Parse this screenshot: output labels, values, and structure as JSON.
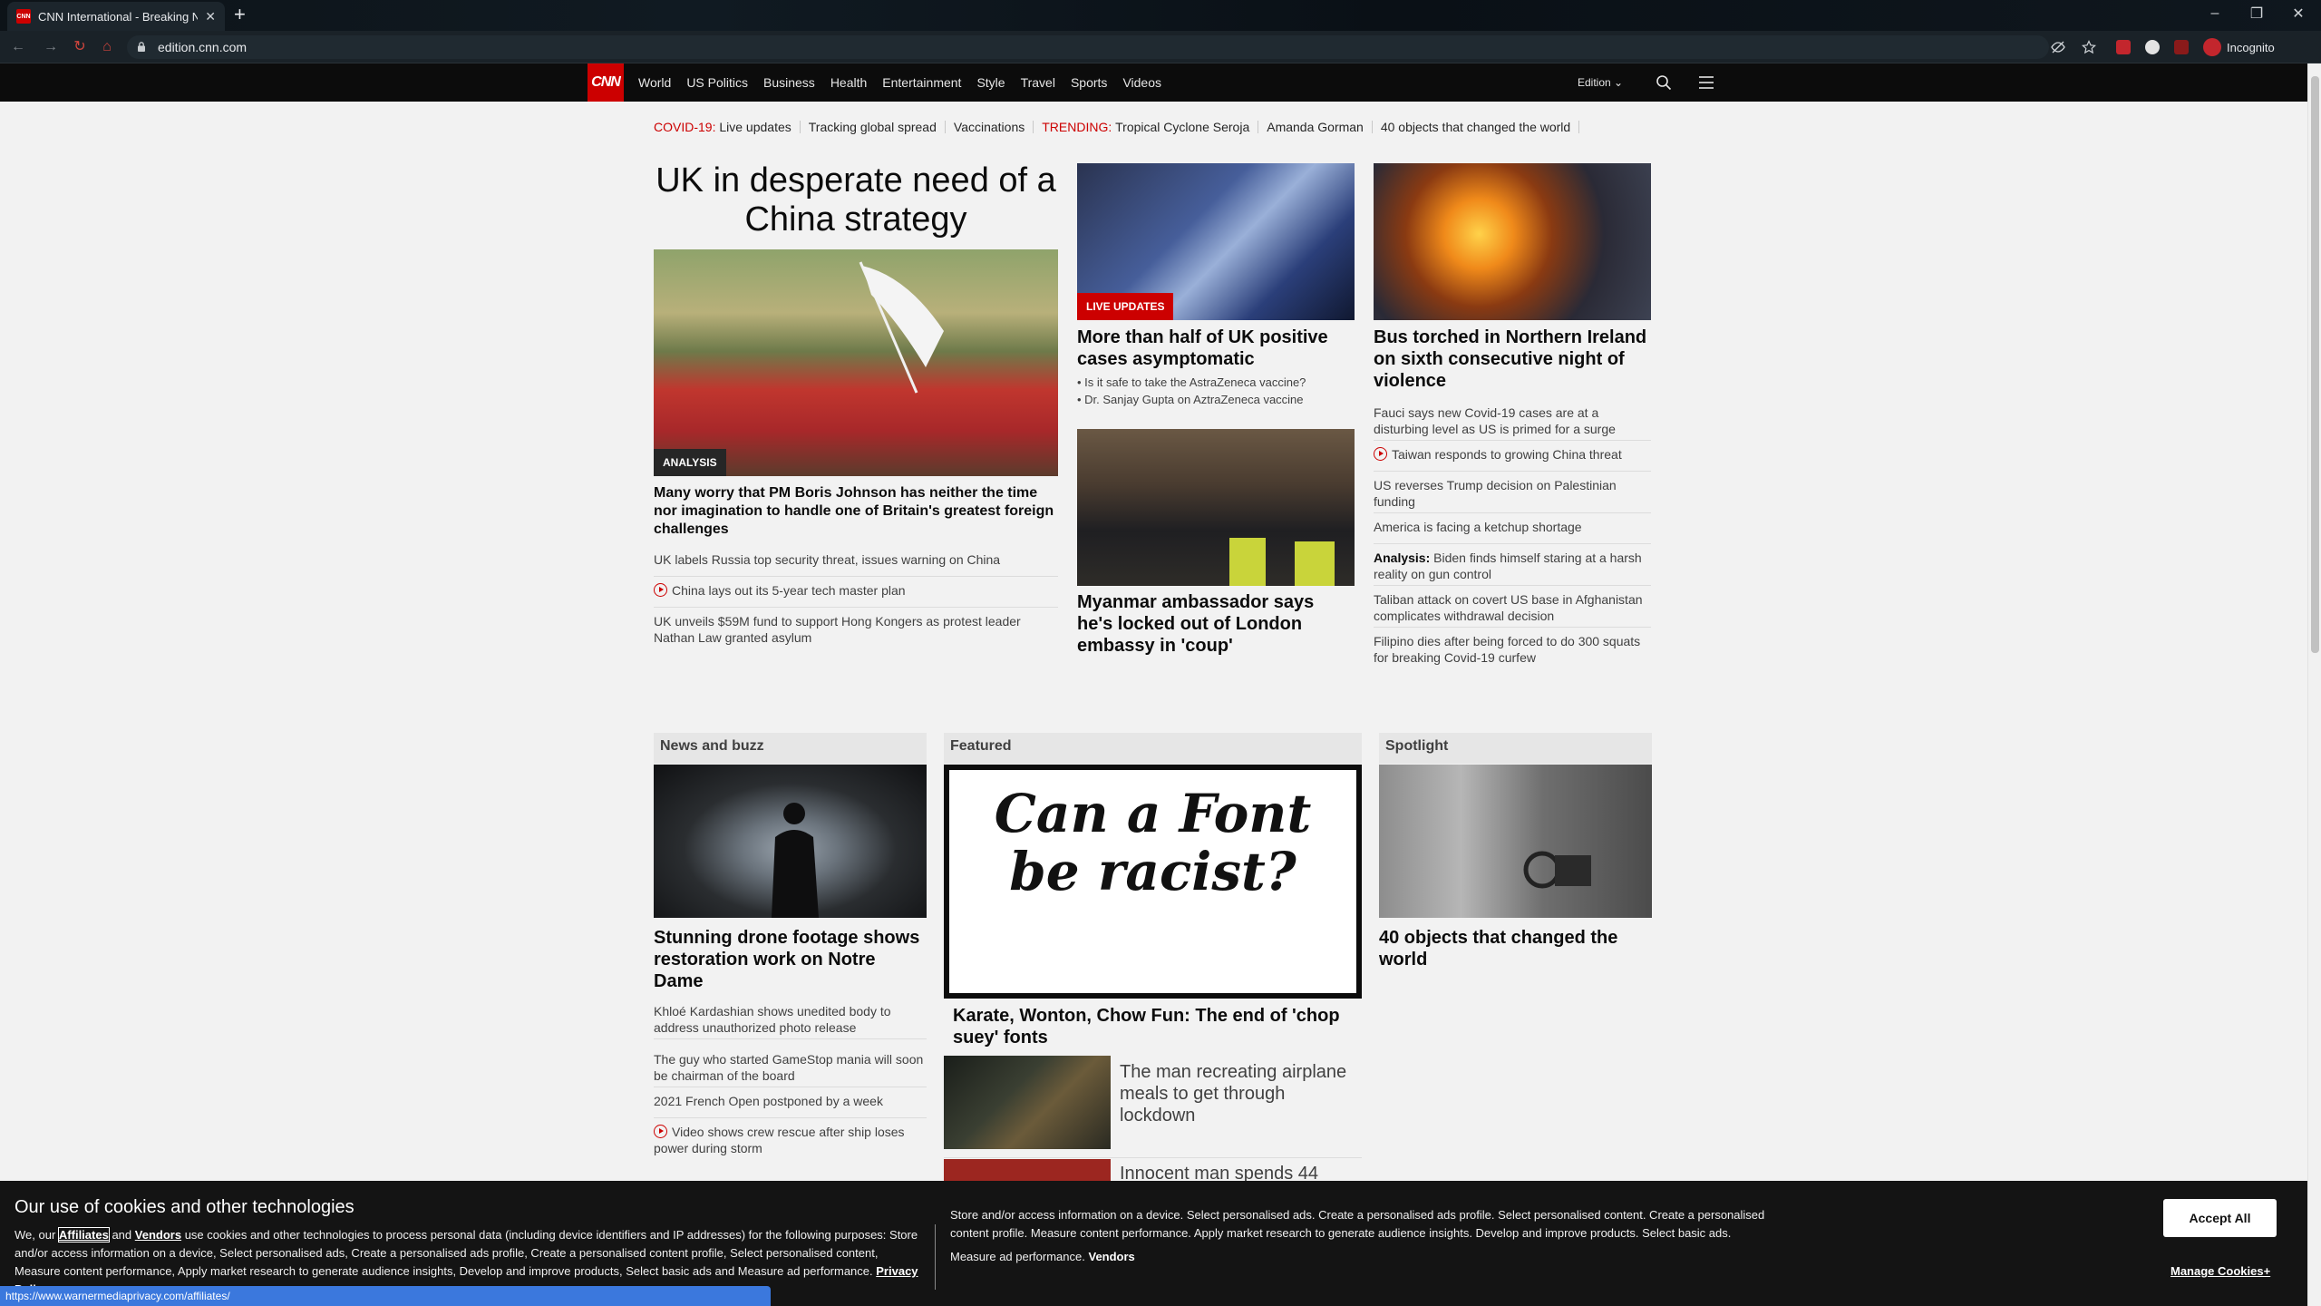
{
  "browser": {
    "tab_title": "CNN International - Breaking News",
    "tab_favicon": "CNN",
    "new_tab": "+",
    "url": "edition.cnn.com",
    "incognito_label": "Incognito",
    "window_controls": {
      "minimize": "–",
      "restore": "❐",
      "close": "✕"
    },
    "icons": [
      "back-icon",
      "forward-icon",
      "reload-icon",
      "home-icon",
      "lock-icon",
      "eye-slash-icon",
      "star-icon",
      "adblock-icon",
      "extension-icon",
      "extension-icon",
      "incognito-icon"
    ]
  },
  "cnn_nav": {
    "logo": "CNN",
    "links": [
      "World",
      "US Politics",
      "Business",
      "Health",
      "Entertainment",
      "Style",
      "Travel",
      "Sports",
      "Videos"
    ],
    "edition": "Edition",
    "icons": [
      "search-icon",
      "hamburger-menu-icon"
    ]
  },
  "trending": {
    "covid_label": "COVID-19:",
    "covid_live": "Live updates",
    "tracking": "Tracking global spread",
    "vaccinations": "Vaccinations",
    "trending_label": "TRENDING:",
    "cyclone": "Tropical Cyclone Seroja",
    "gorman": "Amanda Gorman",
    "objects": "40 objects that changed the world"
  },
  "main_story": {
    "banner": "UK in desperate need of a China strategy",
    "label": "ANALYSIS",
    "headline": "Many worry that PM Boris Johnson has neither the time nor imagination to handle one of Britain's greatest foreign challenges",
    "links": [
      "UK labels Russia top security threat, issues warning on China",
      "China lays out its 5-year tech master plan",
      "UK unveils $59M fund to support Hong Kongers as protest leader Nathan Law granted asylum"
    ]
  },
  "mid_column": {
    "story1": {
      "label": "LIVE UPDATES",
      "headline": "More than half of UK positive cases asymptomatic",
      "bullets": [
        "• Is it safe to take the AstraZeneca vaccine?",
        "• Dr. Sanjay Gupta on AztraZeneca vaccine"
      ]
    },
    "story2": {
      "headline": "Myanmar ambassador says he's locked out of London embassy in 'coup'"
    }
  },
  "right_column": {
    "headline": "Bus torched in Northern Ireland on sixth consecutive night of violence",
    "links": [
      "Fauci says new Covid-19 cases are at a disturbing level as US is primed for a surge",
      "Taiwan responds to growing China threat",
      "US reverses Trump decision on Palestinian funding",
      "America is facing a ketchup shortage",
      "Biden finds himself staring at a harsh reality on gun control",
      "Taliban attack on covert US base in Afghanistan complicates withdrawal decision",
      "Filipino dies after being forced to do 300 squats for breaking Covid-19 curfew"
    ],
    "analysis_label": "Analysis:"
  },
  "news_and_buzz": {
    "title": "News and buzz",
    "headline": "Stunning drone footage shows restoration work on Notre Dame",
    "links": [
      "Khloé Kardashian shows unedited body to address unauthorized photo release",
      "The guy who started GameStop mania will soon be chairman of the board",
      "2021 French Open postponed by a week",
      "Video shows crew rescue after ship loses power during storm"
    ]
  },
  "featured": {
    "title": "Featured",
    "image_text": "Can a Font be racist?",
    "headline": "Karate, Wonton, Chow Fun: The end of 'chop suey' fonts",
    "secondary": "The man recreating airplane meals to get through lockdown",
    "third_partial": "Innocent man spends 44"
  },
  "spotlight": {
    "title": "Spotlight",
    "headline": "40 objects that changed the world"
  },
  "cookie": {
    "title": "Our use of cookies and other technologies",
    "left_pre": "We, our",
    "affiliates": "Affiliates",
    "and": "and",
    "vendors": "Vendors",
    "left_body": "use cookies and other technologies to process personal data (including device identifiers and IP addresses) for the following purposes: Store and/or access information on a device, Select personalised ads, Create a personalised ads profile, Create a personalised content profile, Select personalised content, Measure content performance, Apply market research to generate audience insights, Develop and improve products, Select basic ads and Measure ad performance.",
    "privacy_policy": "Privacy Policy",
    "right_body": "Store and/or access information on a device. Select personalised ads. Create a personalised ads profile. Select personalised content. Create a personalised content profile. Measure content performance. Apply market research to generate audience insights. Develop and improve products. Select basic ads.",
    "right_tail": "Measure ad performance.",
    "right_vendors": "Vendors",
    "accept": "Accept All",
    "manage": "Manage Cookies+"
  },
  "status_url": "https://www.warnermediaprivacy.com/affiliates/",
  "colors": {
    "cnn_red": "#cc0000",
    "nav_bg": "#0c0c0c",
    "page_bg": "#f2f2f2",
    "status_blue": "#3b78dd"
  }
}
